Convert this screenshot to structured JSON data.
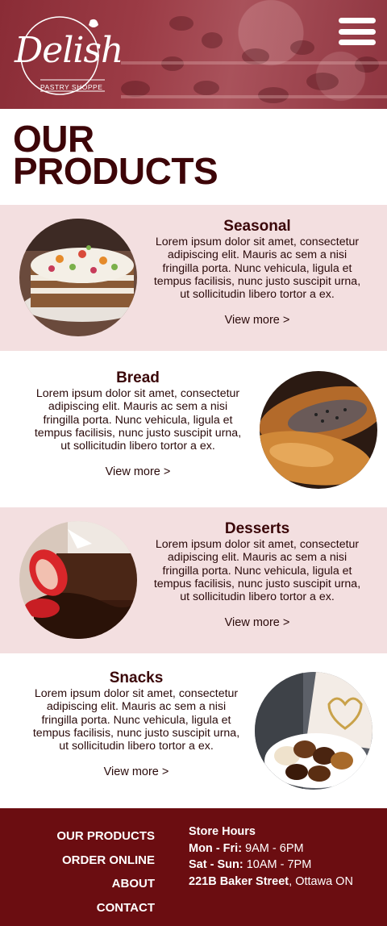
{
  "header": {
    "logo": {
      "name": "Delish",
      "subtitle": "PASTRY SHOPPE"
    },
    "menu_icon": "hamburger-menu-icon"
  },
  "page": {
    "title_line1": "OUR",
    "title_line2": "PRODUCTS"
  },
  "products": [
    {
      "title": "Seasonal",
      "description": "Lorem ipsum dolor sit amet, consectetur adipiscing elit. Mauris ac sem a nisi fringilla porta. Nunc vehicula, ligula et tempus facilisis, nunc justo suscipit urna, ut sollicitudin libero tortor a ex.",
      "link": "View more >",
      "image": "layered-cake-photo"
    },
    {
      "title": "Bread",
      "description": "Lorem ipsum dolor sit amet, consectetur adipiscing elit. Mauris ac sem a nisi fringilla porta. Nunc vehicula, ligula et tempus facilisis, nunc justo suscipit urna, ut sollicitudin libero tortor a ex.",
      "link": "View more >",
      "image": "poppy-seed-bread-photo"
    },
    {
      "title": "Desserts",
      "description": "Lorem ipsum dolor sit amet, consectetur adipiscing elit. Mauris ac sem a nisi fringilla porta. Nunc vehicula, ligula et tempus facilisis, nunc justo suscipit urna, ut sollicitudin libero tortor a ex.",
      "link": "View more >",
      "image": "chocolate-cake-strawberry-photo"
    },
    {
      "title": "Snacks",
      "description": "Lorem ipsum dolor sit amet, consectetur adipiscing elit. Mauris ac sem a nisi fringilla porta. Nunc vehicula, ligula et tempus facilisis, nunc justo suscipit urna, ut sollicitudin libero tortor a ex.",
      "link": "View more >",
      "image": "chocolates-box-photo"
    }
  ],
  "footer": {
    "nav": [
      "OUR PRODUCTS",
      "ORDER ONLINE",
      "ABOUT",
      "CONTACT"
    ],
    "hours_title": "Store Hours",
    "hours": [
      {
        "label": "Mon - Fri:",
        "value": " 9AM - 6PM"
      },
      {
        "label": "Sat - Sun:",
        "value": " 10AM - 7PM"
      }
    ],
    "address_bold": "221B Baker Street",
    "address_rest": ", Ottawa ON"
  },
  "colors": {
    "header_bg": "#9b3b45",
    "title": "#3d0508",
    "pink_section": "#f3dfe0",
    "footer_bg": "#6b0d11"
  }
}
